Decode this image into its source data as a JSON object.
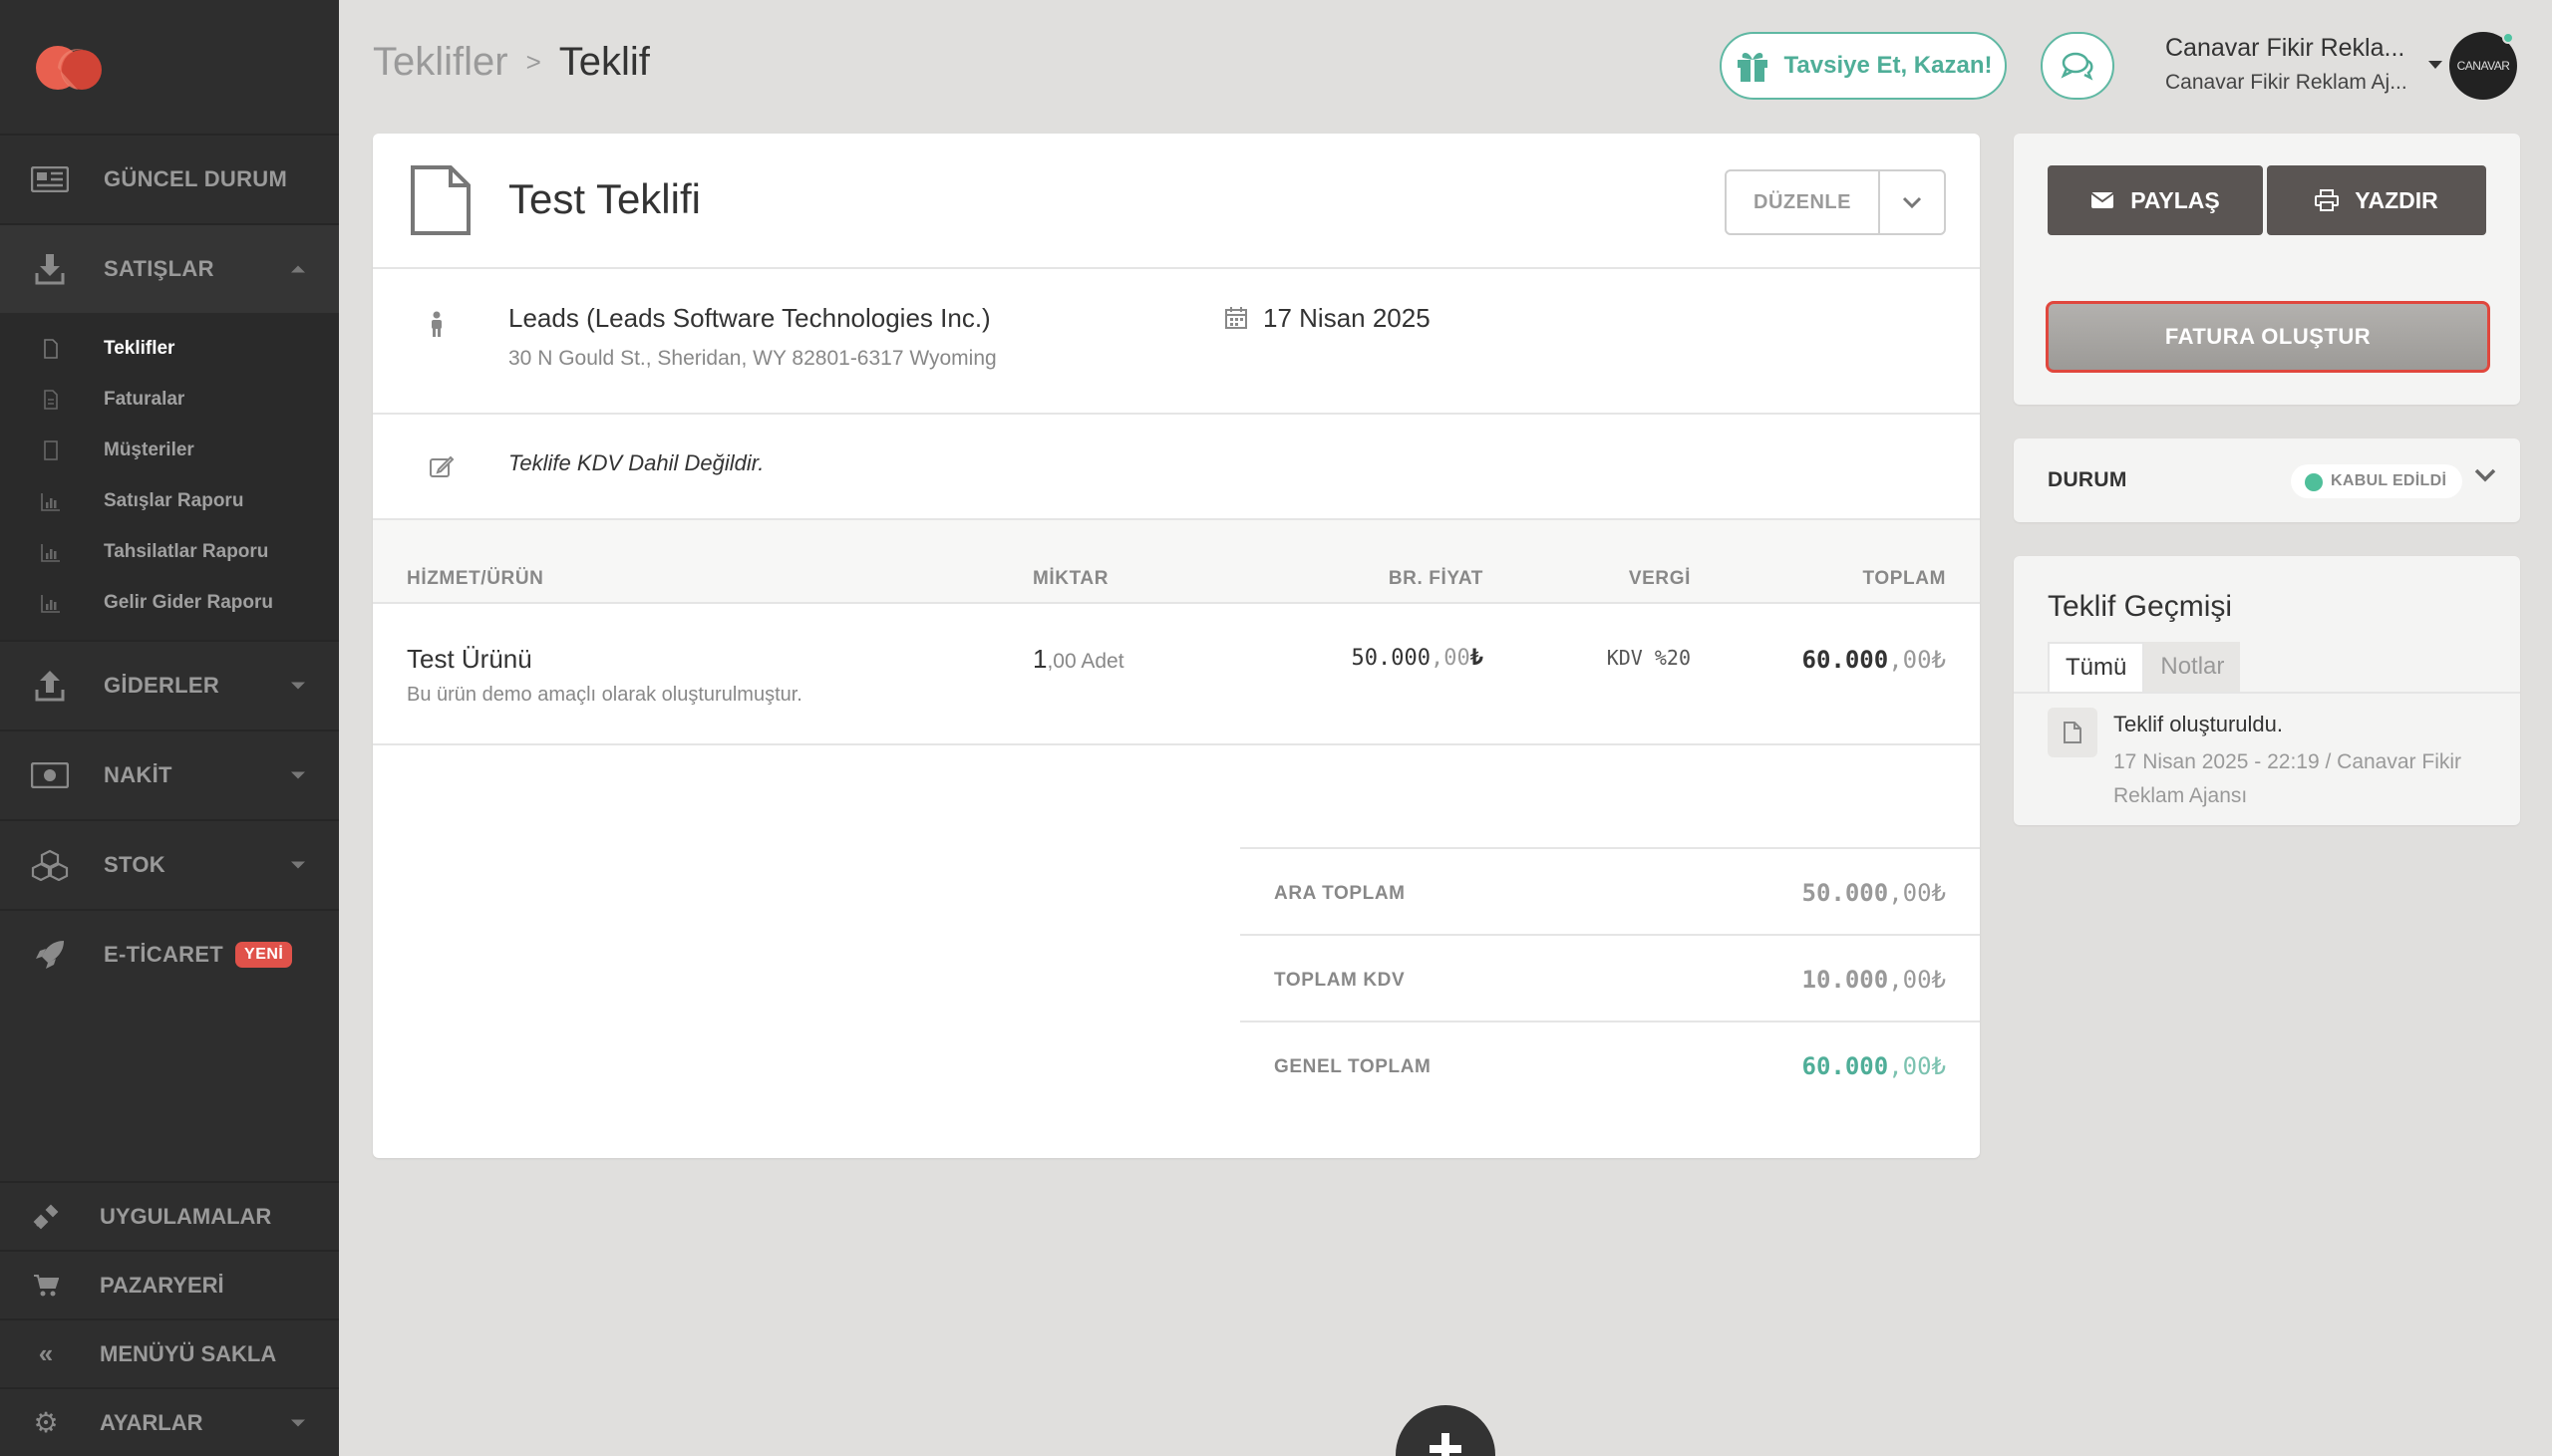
{
  "sidebar": {
    "main": [
      {
        "label": "GÜNCEL DURUM",
        "icon": "newspaper-icon"
      },
      {
        "label": "SATIŞLAR",
        "icon": "download-icon",
        "open": true
      }
    ],
    "sales_sub": [
      {
        "label": "Teklifler",
        "active": true
      },
      {
        "label": "Faturalar"
      },
      {
        "label": "Müşteriler"
      },
      {
        "label": "Satışlar Raporu"
      },
      {
        "label": "Tahsilatlar Raporu"
      },
      {
        "label": "Gelir Gider Raporu"
      }
    ],
    "rest": [
      {
        "label": "GİDERLER",
        "icon": "upload-icon"
      },
      {
        "label": "NAKİT",
        "icon": "money-icon"
      },
      {
        "label": "STOK",
        "icon": "cubes-icon"
      },
      {
        "label": "E-TİCARET",
        "icon": "rocket-icon",
        "badge": "YENİ"
      }
    ],
    "bottom": [
      {
        "label": "UYGULAMALAR",
        "icon": "plug-icon"
      },
      {
        "label": "PAZARYERİ",
        "icon": "cart-icon"
      },
      {
        "label": "MENÜYÜ SAKLA",
        "icon": "double-chevron-left-icon"
      },
      {
        "label": "AYARLAR",
        "icon": "gear-icon"
      }
    ]
  },
  "header": {
    "breadcrumb_parent": "Teklifler",
    "breadcrumb_sep": ">",
    "breadcrumb_current": "Teklif",
    "refer_label": "Tavsiye Et, Kazan!",
    "account_name": "Canavar Fikir Rekla...",
    "account_sub": "Canavar Fikir Reklam Aj...",
    "avatar_text": "CANAVAR"
  },
  "quote": {
    "title": "Test Teklifi",
    "edit_label": "DÜZENLE",
    "client_name": "Leads (Leads Software Technologies Inc.)",
    "client_address": "30 N Gould St., Sheridan, WY 82801-6317 Wyoming",
    "date": "17 Nisan 2025",
    "note": "Teklife KDV Dahil Değildir."
  },
  "table": {
    "headers": {
      "item": "HİZMET/ÜRÜN",
      "qty": "MİKTAR",
      "price": "BR. FİYAT",
      "tax": "VERGİ",
      "total": "TOPLAM"
    },
    "rows": [
      {
        "name": "Test Ürünü",
        "desc": "Bu ürün demo amaçlı olarak oluşturulmuştur.",
        "qty_int": "1",
        "qty_rest": ",00 Adet",
        "price_int": "50.000",
        "price_dec": ",00",
        "price_cur": "₺",
        "tax": "KDV %20",
        "total_int": "60.000",
        "total_dec": ",00₺"
      }
    ]
  },
  "totals": [
    {
      "label": "ARA TOPLAM",
      "int": "50.000",
      "dec": ",00₺"
    },
    {
      "label": "TOPLAM KDV",
      "int": "10.000",
      "dec": ",00₺"
    },
    {
      "label": "GENEL TOPLAM",
      "int": "60.000",
      "dec": ",00₺",
      "accent": "#4fae98"
    }
  ],
  "actions": {
    "share_label": "PAYLAŞ",
    "print_label": "YAZDIR",
    "invoice_label": "FATURA OLUŞTUR"
  },
  "status": {
    "label": "DURUM",
    "value": "KABUL EDİLDİ",
    "color": "#4fbf9a"
  },
  "history": {
    "title": "Teklif Geçmişi",
    "tabs": [
      "Tümü",
      "Notlar"
    ],
    "events": [
      {
        "text": "Teklif oluşturuldu.",
        "meta": "17 Nisan 2025 - 22:19 / Canavar Fikir Reklam Ajansı"
      }
    ]
  },
  "colors": {
    "sidebar_bg": "#2e2e2e",
    "accent_green": "#4fae98",
    "danger_red": "#e0473d",
    "badge_red": "#e0524a"
  }
}
